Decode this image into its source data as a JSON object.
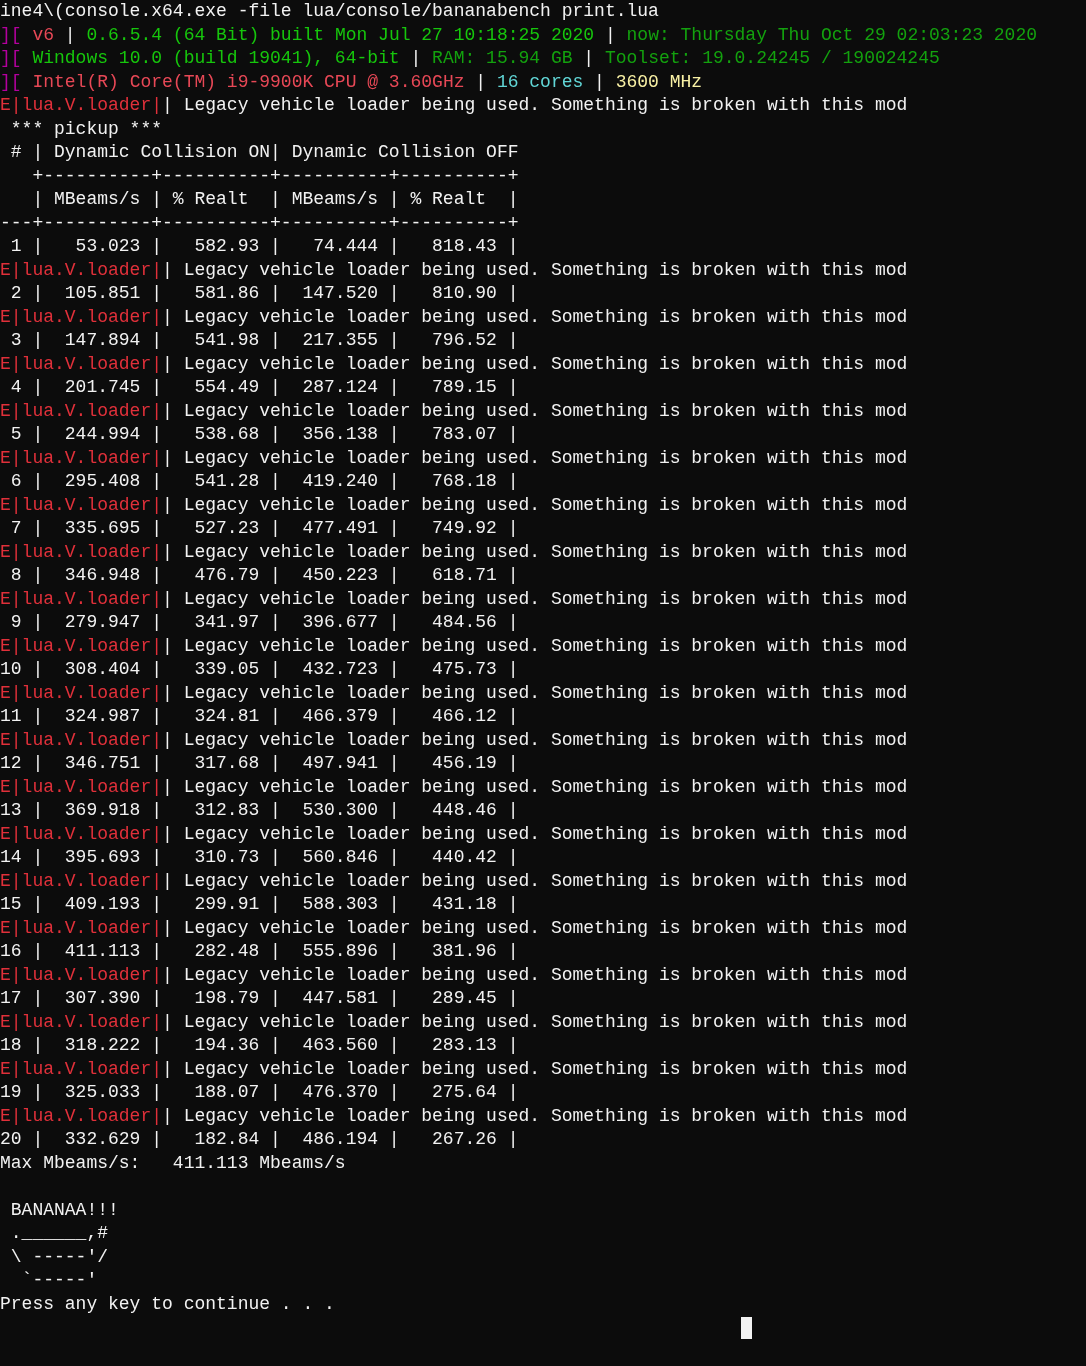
{
  "command_line": "ine4\\(console.x64.exe -file lua/console/bananabench print.lua",
  "system_info": [
    {
      "segments": [
        {
          "text": "][",
          "color": "#b4009e"
        },
        {
          "text": " v6 ",
          "color": "#e74856"
        },
        {
          "text": "| "
        },
        {
          "text": "0.6.5.4 (64 Bit) built Mon Jul 27 10:18:25 2020",
          "color": "#16c60c"
        },
        {
          "text": " | "
        },
        {
          "text": "now: Thursday Thu Oct 29 02:03:23 2020",
          "color": "#13a10e"
        }
      ]
    },
    {
      "segments": [
        {
          "text": "][",
          "color": "#b4009e"
        },
        {
          "text": " Windows 10.0 (build 19041), 64-bit",
          "color": "#16c60c"
        },
        {
          "text": " | "
        },
        {
          "text": "RAM: 15.94 GB",
          "color": "#13a10e"
        },
        {
          "text": " | "
        },
        {
          "text": "Toolset: 19.0.24245 / 190024245",
          "color": "#13a10e"
        }
      ]
    },
    {
      "segments": [
        {
          "text": "][",
          "color": "#b4009e"
        },
        {
          "text": " Intel(R) Core(TM) i9-9900K CPU @ 3.60GHz",
          "color": "#e74856"
        },
        {
          "text": " | "
        },
        {
          "text": "16 cores",
          "color": "#61d6d6"
        },
        {
          "text": " | "
        },
        {
          "text": "3600 MHz",
          "color": "#f9f1a5"
        }
      ]
    }
  ],
  "log": [
    {
      "kind": "warning",
      "prefix": "E|lua.V.loader|",
      "message": "| Legacy vehicle loader being used. Something is broken with this mod"
    },
    {
      "kind": "text",
      "text": " *** pickup ***"
    },
    {
      "kind": "text",
      "text": " # | Dynamic Collision ON| Dynamic Collision OFF"
    },
    {
      "kind": "text",
      "text": "   +----------+----------+----------+----------+"
    },
    {
      "kind": "text",
      "text": "   | MBeams/s | % Realt  | MBeams/s | % Realt  |"
    },
    {
      "kind": "text",
      "text": "---+----------+----------+----------+----------+"
    },
    {
      "kind": "row",
      "text": " 1 |   53.023 |   582.93 |   74.444 |   818.43 |"
    },
    {
      "kind": "warning",
      "prefix": "E|lua.V.loader|",
      "message": "| Legacy vehicle loader being used. Something is broken with this mod"
    },
    {
      "kind": "row",
      "text": " 2 |  105.851 |   581.86 |  147.520 |   810.90 |"
    },
    {
      "kind": "warning",
      "prefix": "E|lua.V.loader|",
      "message": "| Legacy vehicle loader being used. Something is broken with this mod"
    },
    {
      "kind": "row",
      "text": " 3 |  147.894 |   541.98 |  217.355 |   796.52 |"
    },
    {
      "kind": "warning",
      "prefix": "E|lua.V.loader|",
      "message": "| Legacy vehicle loader being used. Something is broken with this mod"
    },
    {
      "kind": "row",
      "text": " 4 |  201.745 |   554.49 |  287.124 |   789.15 |"
    },
    {
      "kind": "warning",
      "prefix": "E|lua.V.loader|",
      "message": "| Legacy vehicle loader being used. Something is broken with this mod"
    },
    {
      "kind": "row",
      "text": " 5 |  244.994 |   538.68 |  356.138 |   783.07 |"
    },
    {
      "kind": "warning",
      "prefix": "E|lua.V.loader|",
      "message": "| Legacy vehicle loader being used. Something is broken with this mod"
    },
    {
      "kind": "row",
      "text": " 6 |  295.408 |   541.28 |  419.240 |   768.18 |"
    },
    {
      "kind": "warning",
      "prefix": "E|lua.V.loader|",
      "message": "| Legacy vehicle loader being used. Something is broken with this mod"
    },
    {
      "kind": "row",
      "text": " 7 |  335.695 |   527.23 |  477.491 |   749.92 |"
    },
    {
      "kind": "warning",
      "prefix": "E|lua.V.loader|",
      "message": "| Legacy vehicle loader being used. Something is broken with this mod"
    },
    {
      "kind": "row",
      "text": " 8 |  346.948 |   476.79 |  450.223 |   618.71 |"
    },
    {
      "kind": "warning",
      "prefix": "E|lua.V.loader|",
      "message": "| Legacy vehicle loader being used. Something is broken with this mod"
    },
    {
      "kind": "row",
      "text": " 9 |  279.947 |   341.97 |  396.677 |   484.56 |"
    },
    {
      "kind": "warning",
      "prefix": "E|lua.V.loader|",
      "message": "| Legacy vehicle loader being used. Something is broken with this mod"
    },
    {
      "kind": "row",
      "text": "10 |  308.404 |   339.05 |  432.723 |   475.73 |"
    },
    {
      "kind": "warning",
      "prefix": "E|lua.V.loader|",
      "message": "| Legacy vehicle loader being used. Something is broken with this mod"
    },
    {
      "kind": "row",
      "text": "11 |  324.987 |   324.81 |  466.379 |   466.12 |"
    },
    {
      "kind": "warning",
      "prefix": "E|lua.V.loader|",
      "message": "| Legacy vehicle loader being used. Something is broken with this mod"
    },
    {
      "kind": "row",
      "text": "12 |  346.751 |   317.68 |  497.941 |   456.19 |"
    },
    {
      "kind": "warning",
      "prefix": "E|lua.V.loader|",
      "message": "| Legacy vehicle loader being used. Something is broken with this mod"
    },
    {
      "kind": "row",
      "text": "13 |  369.918 |   312.83 |  530.300 |   448.46 |"
    },
    {
      "kind": "warning",
      "prefix": "E|lua.V.loader|",
      "message": "| Legacy vehicle loader being used. Something is broken with this mod"
    },
    {
      "kind": "row",
      "text": "14 |  395.693 |   310.73 |  560.846 |   440.42 |"
    },
    {
      "kind": "warning",
      "prefix": "E|lua.V.loader|",
      "message": "| Legacy vehicle loader being used. Something is broken with this mod"
    },
    {
      "kind": "row",
      "text": "15 |  409.193 |   299.91 |  588.303 |   431.18 |"
    },
    {
      "kind": "warning",
      "prefix": "E|lua.V.loader|",
      "message": "| Legacy vehicle loader being used. Something is broken with this mod"
    },
    {
      "kind": "row",
      "text": "16 |  411.113 |   282.48 |  555.896 |   381.96 |"
    },
    {
      "kind": "warning",
      "prefix": "E|lua.V.loader|",
      "message": "| Legacy vehicle loader being used. Something is broken with this mod"
    },
    {
      "kind": "row",
      "text": "17 |  307.390 |   198.79 |  447.581 |   289.45 |"
    },
    {
      "kind": "warning",
      "prefix": "E|lua.V.loader|",
      "message": "| Legacy vehicle loader being used. Something is broken with this mod"
    },
    {
      "kind": "row",
      "text": "18 |  318.222 |   194.36 |  463.560 |   283.13 |"
    },
    {
      "kind": "warning",
      "prefix": "E|lua.V.loader|",
      "message": "| Legacy vehicle loader being used. Something is broken with this mod"
    },
    {
      "kind": "row",
      "text": "19 |  325.033 |   188.07 |  476.370 |   275.64 |"
    },
    {
      "kind": "warning",
      "prefix": "E|lua.V.loader|",
      "message": "| Legacy vehicle loader being used. Something is broken with this mod"
    },
    {
      "kind": "row",
      "text": "20 |  332.629 |   182.84 |  486.194 |   267.26 |"
    },
    {
      "kind": "text",
      "text": "Max Mbeams/s:   411.113 Mbeams/s"
    },
    {
      "kind": "blank"
    },
    {
      "kind": "text",
      "text": " BANANAA!!!"
    },
    {
      "kind": "art",
      "lines": [
        " .______,#",
        " \\ -----'/",
        "  `-----'"
      ]
    },
    {
      "kind": "text",
      "text": "Press any key to continue . . ."
    }
  ]
}
